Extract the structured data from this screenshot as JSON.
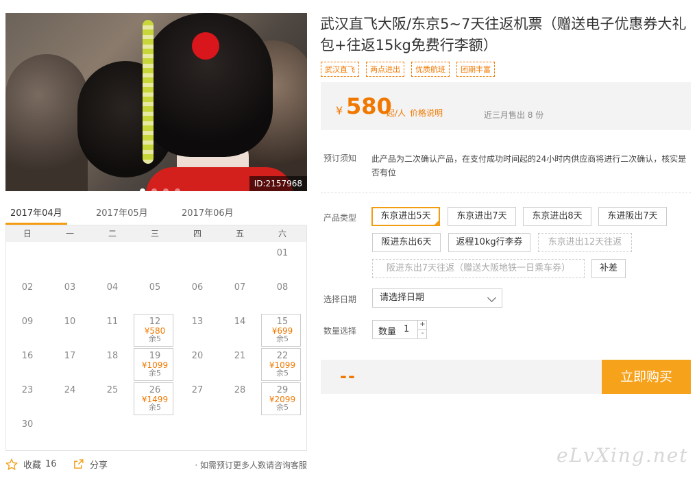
{
  "hero": {
    "image_id": "ID:2157968",
    "dots": 4,
    "active_dot": 0
  },
  "calendar": {
    "tabs": [
      "2017年04月",
      "2017年05月",
      "2017年06月"
    ],
    "weekdays": [
      "日",
      "一",
      "二",
      "三",
      "四",
      "五",
      "六"
    ],
    "days": [
      {
        "d": ""
      },
      {
        "d": ""
      },
      {
        "d": ""
      },
      {
        "d": ""
      },
      {
        "d": ""
      },
      {
        "d": ""
      },
      {
        "d": "01"
      },
      {
        "d": "02"
      },
      {
        "d": "03"
      },
      {
        "d": "04"
      },
      {
        "d": "05"
      },
      {
        "d": "06"
      },
      {
        "d": "07"
      },
      {
        "d": "08"
      },
      {
        "d": "09"
      },
      {
        "d": "10"
      },
      {
        "d": "11"
      },
      {
        "d": "12",
        "price": "¥580",
        "left": "余5"
      },
      {
        "d": "13"
      },
      {
        "d": "14"
      },
      {
        "d": "15",
        "price": "¥699",
        "left": "余5"
      },
      {
        "d": "16"
      },
      {
        "d": "17"
      },
      {
        "d": "18"
      },
      {
        "d": "19",
        "price": "¥1099",
        "left": "余5"
      },
      {
        "d": "20"
      },
      {
        "d": "21"
      },
      {
        "d": "22",
        "price": "¥1099",
        "left": "余5"
      },
      {
        "d": "23"
      },
      {
        "d": "24"
      },
      {
        "d": "25"
      },
      {
        "d": "26",
        "price": "¥1499",
        "left": "余5"
      },
      {
        "d": "27"
      },
      {
        "d": "28"
      },
      {
        "d": "29",
        "price": "¥2099",
        "left": "余5"
      },
      {
        "d": "30"
      }
    ]
  },
  "footer": {
    "favorite_label": "收藏",
    "favorite_count": "16",
    "share_label": "分享",
    "note": "如需预订更多人数请咨询客服"
  },
  "product": {
    "title": "武汉直飞大阪/东京5~7天往返机票（赠送电子优惠券大礼包+往返15kg免费行李额）",
    "tags": [
      "武汉直飞",
      "两点进出",
      "优质航班",
      "团期丰富"
    ],
    "currency": "¥",
    "price": "580",
    "price_unit": "起/人",
    "price_explain": "价格说明",
    "sold": "近三月售出 8 份",
    "notice_label": "预订须知",
    "notice_text": "此产品为二次确认产品，在支付成功时间起的24小时内供应商将进行二次确认，核实是否有位",
    "type_label": "产品类型",
    "types": [
      {
        "label": "东京进出5天",
        "state": "selected"
      },
      {
        "label": "东京进出7天",
        "state": "normal"
      },
      {
        "label": "东京进出8天",
        "state": "normal"
      },
      {
        "label": "东进阪出7天",
        "state": "normal"
      },
      {
        "label": "阪进东出6天",
        "state": "normal"
      },
      {
        "label": "返程10kg行李券",
        "state": "normal"
      },
      {
        "label": "东京进出12天往返",
        "state": "disabled"
      },
      {
        "label": "阪进东出7天往返（赠送大阪地铁一日乘车券）",
        "state": "disabled"
      },
      {
        "label": "补差",
        "state": "normal"
      }
    ],
    "date_label": "选择日期",
    "date_placeholder": "请选择日期",
    "qty_label": "数量选择",
    "qty_field_label": "数量",
    "qty_value": "1",
    "qty_plus": "+",
    "qty_minus": "-",
    "total": "--",
    "buy_label": "立即购买"
  },
  "watermark": "eLvXing.net",
  "colors": {
    "accent": "#f07800",
    "button": "#f7a21b",
    "panel": "#f3f3f3"
  }
}
